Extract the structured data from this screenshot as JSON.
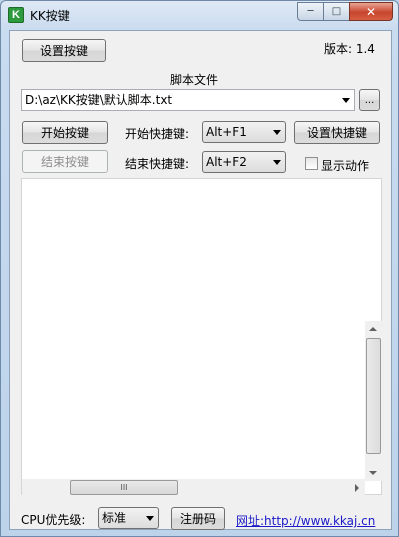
{
  "window": {
    "title": "KK按键",
    "icon_letter": "K",
    "controls": {
      "minimize": "─",
      "maximize": "□",
      "close": "✕"
    }
  },
  "top": {
    "set_keys_label": "设置按键",
    "version_text": "版本: 1.4"
  },
  "script": {
    "label": "脚本文件",
    "path": "D:\\az\\KK按键\\默认脚本.txt",
    "browse_label": "..."
  },
  "controls": {
    "start_label": "开始按键",
    "stop_label": "结束按键",
    "start_hotkey_label": "开始快捷键:",
    "stop_hotkey_label": "结束快捷键:",
    "start_hotkey_value": "Alt+F1",
    "stop_hotkey_value": "Alt+F2",
    "set_hotkey_label": "设置快捷键",
    "show_action_label": "显示动作",
    "show_action_checked": false
  },
  "scrollbar": {
    "h_thumb_grip": "III"
  },
  "bottom": {
    "cpu_label": "CPU优先级:",
    "cpu_value": "标准",
    "register_label": "注册码",
    "website_text": "网址:http://www.kkaj.cn"
  }
}
